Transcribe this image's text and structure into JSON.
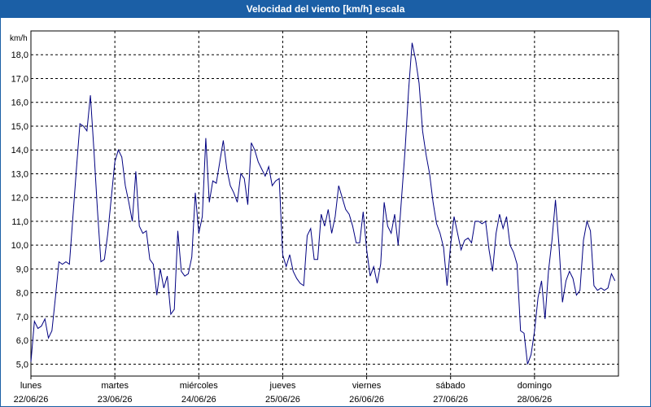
{
  "chart_data": {
    "type": "line",
    "title": "Velocidad del viento [km/h] escala",
    "ylabel": "km/h",
    "xlabel": "",
    "ylim": [
      4.5,
      19.0
    ],
    "yticks": [
      "5,0",
      "6,0",
      "7,0",
      "8,0",
      "9,0",
      "10,0",
      "11,0",
      "12,0",
      "13,0",
      "14,0",
      "15,0",
      "16,0",
      "17,0",
      "18,0"
    ],
    "x_tick_days": [
      {
        "day": "lunes",
        "date": "22/06/26"
      },
      {
        "day": "martes",
        "date": "23/06/26"
      },
      {
        "day": "miércoles",
        "date": "24/06/26"
      },
      {
        "day": "jueves",
        "date": "25/06/26"
      },
      {
        "day": "viernes",
        "date": "26/06/26"
      },
      {
        "day": "sábado",
        "date": "27/06/26"
      },
      {
        "day": "domingo",
        "date": "28/06/26"
      }
    ],
    "grid": true,
    "line_color": "#000080",
    "series": [
      {
        "x_hours": [
          0,
          1,
          2,
          3,
          4,
          5,
          6,
          7,
          8,
          9,
          10,
          11,
          12,
          13,
          14,
          15,
          16,
          17,
          18,
          19,
          20,
          21,
          22,
          23,
          24,
          25,
          26,
          27,
          28,
          29,
          30,
          31,
          32,
          33,
          34,
          35,
          36,
          37,
          38,
          39,
          40,
          41,
          42,
          43,
          44,
          45,
          46,
          47,
          48,
          49,
          50,
          51,
          52,
          53,
          54,
          55,
          56,
          57,
          58,
          59,
          60,
          61,
          62,
          63,
          64,
          65,
          66,
          67,
          68,
          69,
          70,
          71,
          72,
          73,
          74,
          75,
          76,
          77,
          78,
          79,
          80,
          81,
          82,
          83,
          84,
          85,
          86,
          87,
          88,
          89,
          90,
          91,
          92,
          93,
          94,
          95,
          96,
          97,
          98,
          99,
          100,
          101,
          102,
          103,
          104,
          105,
          106,
          107,
          108,
          109,
          110,
          111,
          112,
          113,
          114,
          115,
          116,
          117,
          118,
          119,
          120,
          121,
          122,
          123,
          124,
          125,
          126,
          127,
          128,
          129,
          130,
          131,
          132,
          133,
          134,
          135,
          136,
          137,
          138,
          139,
          140,
          141,
          142,
          143,
          144,
          145,
          146,
          147,
          148,
          149,
          150,
          151,
          152,
          153,
          154,
          155,
          156,
          157,
          158,
          159,
          160,
          161,
          162,
          163,
          164,
          165,
          166,
          167
        ],
        "values": [
          5.1,
          6.8,
          6.5,
          6.6,
          6.9,
          6.1,
          6.4,
          7.8,
          9.3,
          9.2,
          9.3,
          9.2,
          11.2,
          13.2,
          15.1,
          15.0,
          14.8,
          16.3,
          14.0,
          11.5,
          9.3,
          9.4,
          10.5,
          12.0,
          13.5,
          14.0,
          13.7,
          12.5,
          11.8,
          11.0,
          13.1,
          10.8,
          10.5,
          10.6,
          9.4,
          9.2,
          7.9,
          9.0,
          8.2,
          8.7,
          7.1,
          7.3,
          10.6,
          8.9,
          8.7,
          8.8,
          9.5,
          12.2,
          10.5,
          11.2,
          14.5,
          11.8,
          12.7,
          12.6,
          13.5,
          14.4,
          13.2,
          12.5,
          12.2,
          11.8,
          13.0,
          12.8,
          11.7,
          14.3,
          14.0,
          13.5,
          13.2,
          12.9,
          13.3,
          12.5,
          12.7,
          12.8,
          9.6,
          9.1,
          9.6,
          8.9,
          8.6,
          8.4,
          8.3,
          10.4,
          10.7,
          9.4,
          9.4,
          11.3,
          10.8,
          11.5,
          10.5,
          11.2,
          12.5,
          12.0,
          11.5,
          11.3,
          10.8,
          10.1,
          10.1,
          11.4,
          9.8,
          8.7,
          9.1,
          8.4,
          9.2,
          11.8,
          10.8,
          10.5,
          11.3,
          10.0,
          12.0,
          14.0,
          16.5,
          18.5,
          17.8,
          16.8,
          14.8,
          13.8,
          13.0,
          11.8,
          10.9,
          10.5,
          9.9,
          8.3,
          10.0,
          11.2,
          10.5,
          9.8,
          10.2,
          10.3,
          10.1,
          11.0,
          11.0,
          10.9,
          11.0,
          9.8,
          8.9,
          10.5,
          11.3,
          10.7,
          11.2,
          10.0,
          9.7,
          9.2,
          6.4,
          6.3,
          5.0,
          5.4,
          6.4,
          7.8,
          8.5,
          6.9,
          8.9,
          10.2,
          11.9,
          10.0,
          7.6,
          8.5,
          8.9,
          8.6,
          7.9,
          8.1,
          10.2,
          11.0,
          10.6,
          8.3,
          8.1,
          8.2,
          8.1,
          8.2,
          8.8,
          8.5
        ]
      }
    ]
  }
}
